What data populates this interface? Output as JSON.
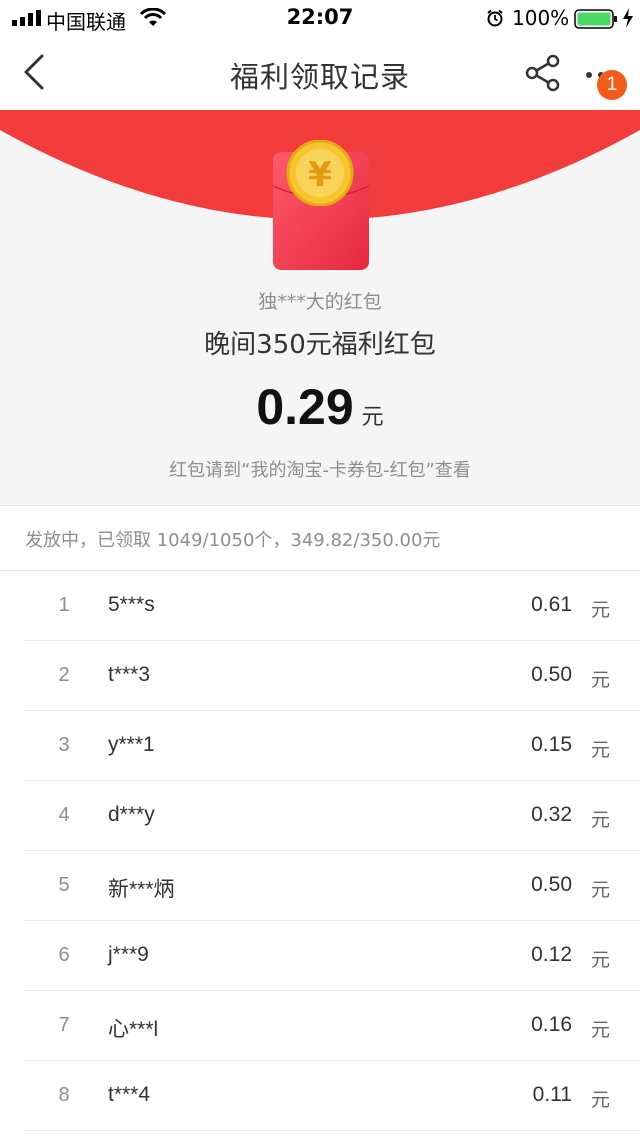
{
  "status_bar": {
    "carrier": "中国联通",
    "time": "22:07",
    "battery": "100%"
  },
  "nav": {
    "title": "福利领取记录",
    "badge": "1"
  },
  "packet": {
    "sender": "独***大的红包",
    "title": "晚间350元福利红包",
    "amount": "0.29",
    "unit": "元",
    "hint": "红包请到“我的淘宝-卡券包-红包”查看",
    "coin_symbol": "¥"
  },
  "summary": "发放中，已领取 1049/1050个，349.82/350.00元",
  "records": [
    {
      "rank": "1",
      "name": "5***s",
      "amount": "0.61",
      "unit": "元"
    },
    {
      "rank": "2",
      "name": "t***3",
      "amount": "0.50",
      "unit": "元"
    },
    {
      "rank": "3",
      "name": "y***1",
      "amount": "0.15",
      "unit": "元"
    },
    {
      "rank": "4",
      "name": "d***y",
      "amount": "0.32",
      "unit": "元"
    },
    {
      "rank": "5",
      "name": "新***炳",
      "amount": "0.50",
      "unit": "元"
    },
    {
      "rank": "6",
      "name": "j***9",
      "amount": "0.12",
      "unit": "元"
    },
    {
      "rank": "7",
      "name": "心***l",
      "amount": "0.16",
      "unit": "元"
    },
    {
      "rank": "8",
      "name": "t***4",
      "amount": "0.11",
      "unit": "元"
    }
  ],
  "colors": {
    "red": "#f23b3b",
    "coin": "#f7c52e",
    "badge": "#f25c1a",
    "battery": "#4cd964"
  },
  "icons": [
    "signal-icon",
    "wifi-icon",
    "alarm-icon",
    "battery-icon",
    "charging-icon",
    "back-arrow-icon",
    "share-icon",
    "more-icon",
    "red-packet-icon",
    "coin-icon"
  ]
}
